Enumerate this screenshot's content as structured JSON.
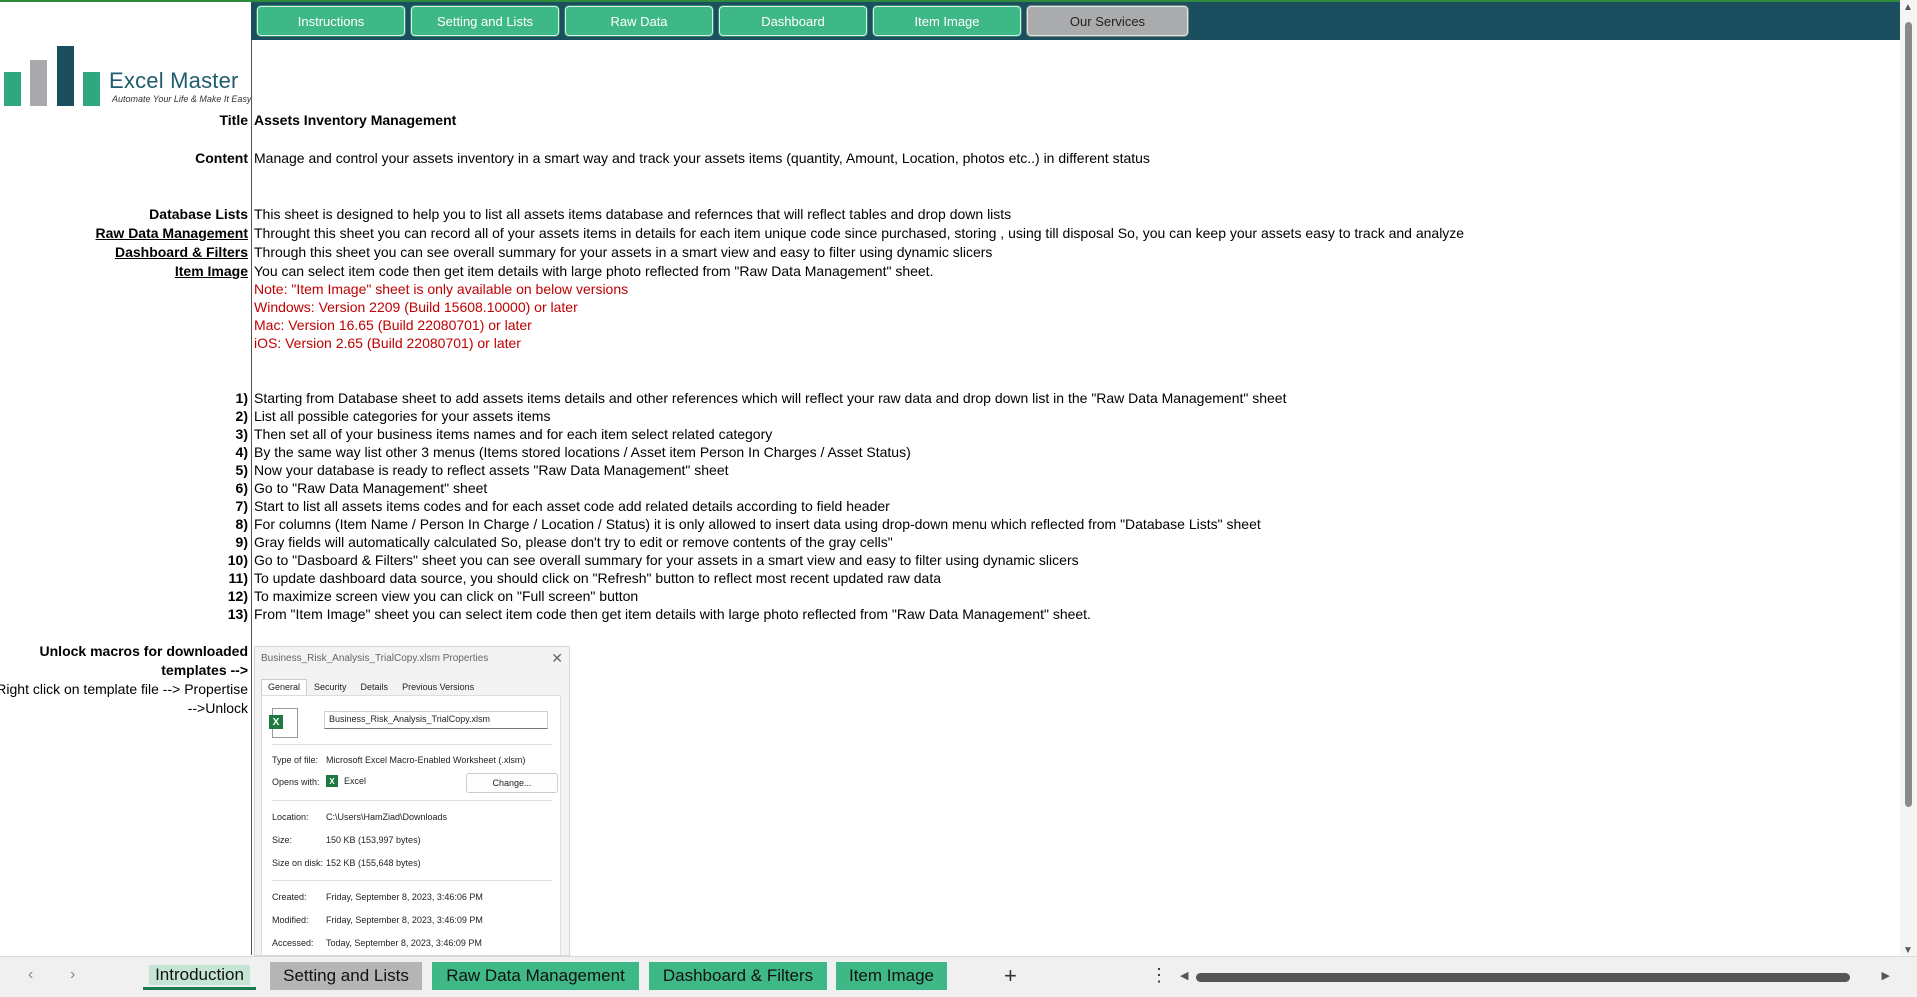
{
  "nav": {
    "buttons": [
      "Instructions",
      "Setting and Lists",
      "Raw Data",
      "Dashboard",
      "Item Image",
      "Our Services"
    ]
  },
  "logo": {
    "brand": "Excel Master",
    "tagline": "Automate Your Life & Make It Easy"
  },
  "intro": {
    "title_label": "Title",
    "title_value": "Assets Inventory Management",
    "content_label": "Content",
    "content_value": "Manage and control your assets inventory in a smart way and track your assets items (quantity, Amount, Location, photos etc..) in different status",
    "sections": [
      {
        "label": "Database Lists",
        "text": "This sheet is designed to help you to list all assets items database and refernces that will reflect tables and drop down lists"
      },
      {
        "label": "Raw Data Management",
        "text": "Throught this sheet you can record all of your assets items in details for each item unique code since purchased, storing , using till disposal So, you can keep your assets easy to track and analyze"
      },
      {
        "label": "Dashboard & Filters",
        "text": "Through this sheet you can see overall summary for your assets in a smart view and easy to filter using dynamic slicers"
      },
      {
        "label": "Item Image",
        "text": "You can select item code then get item details with large photo reflected from \"Raw Data Management\" sheet."
      }
    ],
    "notes": [
      "Note: \"Item Image\" sheet is only available on below versions",
      "Windows: Version 2209 (Build 15608.10000) or later",
      "Mac: Version 16.65 (Build 22080701) or later",
      "iOS: Version 2.65 (Build 22080701) or later"
    ],
    "steps": [
      {
        "n": "1)",
        "text": "Starting from Database sheet to add assets items details and other references which will reflect your raw data and drop down list in the \"Raw Data Management\" sheet"
      },
      {
        "n": "2)",
        "text": "List all possible categories for your assets items"
      },
      {
        "n": "3)",
        "text": "Then set all of your business items names and for each item select related category"
      },
      {
        "n": "4)",
        "text": "By the same way list other 3 menus (Items stored locations / Asset item Person In Charges / Asset Status)"
      },
      {
        "n": "5)",
        "text": "Now your database is ready to reflect assets \"Raw Data Management\" sheet"
      },
      {
        "n": "6)",
        "text": "Go to \"Raw Data Management\" sheet"
      },
      {
        "n": "7)",
        "text": "Start to list all assets items codes and for each asset code add related details according to field header"
      },
      {
        "n": "8)",
        "text": "For columns (Item Name / Person In Charge / Location / Status) it is only allowed to insert data using drop-down menu which reflected from \"Database Lists\" sheet"
      },
      {
        "n": "9)",
        "text": "Gray fields will automatically calculated So, please don't try to edit or remove contents of the gray cells\""
      },
      {
        "n": "10)",
        "text": "Go to \"Dasboard & Filters\" sheet you can see overall summary for your assets in a smart view and easy to filter using dynamic slicers"
      },
      {
        "n": "11)",
        "text": "To update dashboard data source, you should click on \"Refresh\" button to reflect most recent updated raw data"
      },
      {
        "n": "12)",
        "text": "To maximize screen view you can click on \"Full screen\" button"
      },
      {
        "n": "13)",
        "text": "From \"Item Image\" sheet you can select item code then get item details with large photo reflected from \"Raw Data Management\" sheet."
      }
    ],
    "unlock_label_1": "Unlock macros for downloaded",
    "unlock_label_2": "templates -->",
    "unlock_hint_1": "Right click on template file --> Propertise",
    "unlock_hint_2": "-->Unlock"
  },
  "dialog": {
    "title": "Business_Risk_Analysis_TrialCopy.xlsm Properties",
    "tabs": [
      "General",
      "Security",
      "Details",
      "Previous Versions"
    ],
    "filename": "Business_Risk_Analysis_TrialCopy.xlsm",
    "rows": [
      {
        "k": "Type of file:",
        "v": "Microsoft Excel Macro-Enabled Worksheet (.xlsm)"
      },
      {
        "k": "Opens with:",
        "v": "Excel"
      },
      {
        "k": "Location:",
        "v": "C:\\Users\\HamZiad\\Downloads"
      },
      {
        "k": "Size:",
        "v": "150 KB (153,997 bytes)"
      },
      {
        "k": "Size on disk:",
        "v": "152 KB (155,648 bytes)"
      },
      {
        "k": "Created:",
        "v": "Friday, September 8, 2023, 3:46:06 PM"
      },
      {
        "k": "Modified:",
        "v": "Friday, September 8, 2023, 3:46:09 PM"
      },
      {
        "k": "Accessed:",
        "v": "Today, September 8, 2023, 3:46:09 PM"
      }
    ],
    "change_label": "Change..."
  },
  "sheet_tabs": [
    "Introduction",
    "Setting and Lists",
    "Raw Data Management",
    "Dashboard & Filters",
    "Item Image"
  ],
  "colors": {
    "header": "#1b4e5f",
    "accent_green": "#3fb887",
    "note_red": "#c00000"
  }
}
